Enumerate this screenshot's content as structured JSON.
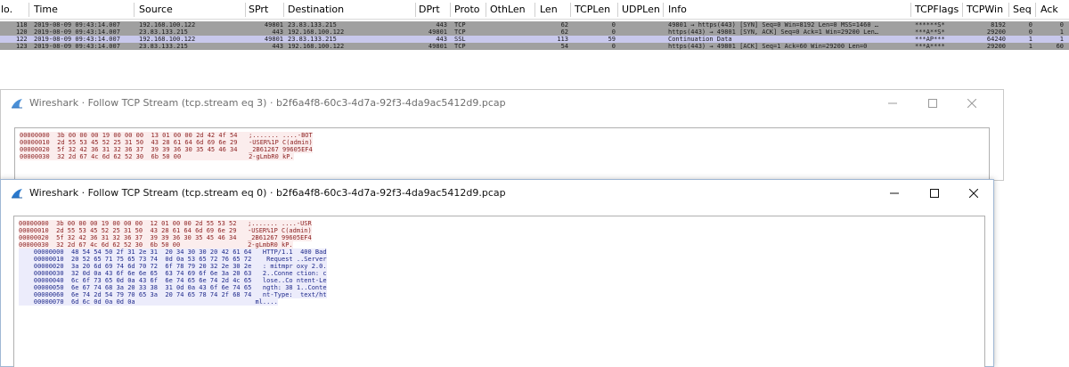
{
  "packet_list": {
    "columns": [
      "lo.",
      "Time",
      "Source",
      "SPrt",
      "Destination",
      "DPrt",
      "Proto",
      "OthLen",
      "Len",
      "TCPLen",
      "UDPLen",
      "Info",
      "TCPFlags",
      "TCPWin",
      "Seq",
      "Ack"
    ],
    "rows": [
      {
        "no": "118",
        "time": "2019-08-09 09:43:14.007",
        "source": "192.168.100.122",
        "sprt": "49801",
        "destination": "23.83.133.215",
        "dprt": "443",
        "proto": "TCP",
        "len": "62",
        "tcplen": "0",
        "info": "49801 → https(443) [SYN] Seq=0 Win=8192 Len=0 MSS=1460 …",
        "tcpflags": "******S*",
        "tcpwin": "8192",
        "seq": "0",
        "ack": "0",
        "bg": "#a0a0a0"
      },
      {
        "no": "120",
        "time": "2019-08-09 09:43:14.007",
        "source": "23.83.133.215",
        "sprt": "443",
        "destination": "192.168.100.122",
        "dprt": "49801",
        "proto": "TCP",
        "len": "62",
        "tcplen": "0",
        "info": "https(443) → 49801 [SYN, ACK] Seq=0 Ack=1 Win=29200 Len…",
        "tcpflags": "***A**S*",
        "tcpwin": "29200",
        "seq": "0",
        "ack": "1",
        "bg": "#a0a0a0"
      },
      {
        "no": "122",
        "time": "2019-08-09 09:43:14.007",
        "source": "192.168.100.122",
        "sprt": "49801",
        "destination": "23.83.133.215",
        "dprt": "443",
        "proto": "SSL",
        "len": "113",
        "tcplen": "59",
        "info": "Continuation Data",
        "tcpflags": "***AP***",
        "tcpwin": "64240",
        "seq": "1",
        "ack": "1",
        "bg": "#c8c8ec"
      },
      {
        "no": "123",
        "time": "2019-08-09 09:43:14.007",
        "source": "23.83.133.215",
        "sprt": "443",
        "destination": "192.168.100.122",
        "dprt": "49801",
        "proto": "TCP",
        "len": "54",
        "tcplen": "0",
        "info": "https(443) → 49801 [ACK] Seq=1 Ack=60 Win=29200 Len=0",
        "tcpflags": "***A****",
        "tcpwin": "29200",
        "seq": "1",
        "ack": "60",
        "bg": "#a0a0a0"
      }
    ]
  },
  "windows": [
    {
      "title": "Wireshark · Follow TCP Stream (tcp.stream eq 3) · b2f6a4f8-60c3-4d7a-92f3-4da9ac5412d9.pcap",
      "lines": [
        {
          "dir": "client",
          "text": "00000000  3b 00 00 00 19 00 00 00  13 01 00 00 2d 42 4f 54   ;....... ....-BOT"
        },
        {
          "dir": "client",
          "text": "00000010  2d 55 53 45 52 25 31 50  43 28 61 64 6d 69 6e 29   -USER%1P C(admin)"
        },
        {
          "dir": "client",
          "text": "00000020  5f 32 42 36 31 32 36 37  39 39 36 30 35 45 46 34   _2B61267 99605EF4"
        },
        {
          "dir": "client",
          "text": "00000030  32 2d 67 4c 6d 62 52 30  6b 50 00                  2-gLmbR0 kP."
        }
      ]
    },
    {
      "title": "Wireshark · Follow TCP Stream (tcp.stream eq 0) · b2f6a4f8-60c3-4d7a-92f3-4da9ac5412d9.pcap",
      "lines": [
        {
          "dir": "client",
          "text": "00000000  3b 00 00 00 19 00 00 00  12 01 00 00 2d 55 53 52   ;....... ....-USR"
        },
        {
          "dir": "client",
          "text": "00000010  2d 55 53 45 52 25 31 50  43 28 61 64 6d 69 6e 29   -USER%1P C(admin)"
        },
        {
          "dir": "client",
          "text": "00000020  5f 32 42 36 31 32 36 37  39 39 36 30 35 45 46 34   _2B61267 99605EF4"
        },
        {
          "dir": "client",
          "text": "00000030  32 2d 67 4c 6d 62 52 30  6b 50 00                  2-gLmbR0 kP."
        },
        {
          "dir": "server",
          "text": "    00000000  48 54 54 50 2f 31 2e 31  20 34 30 30 20 42 61 64   HTTP/1.1  400 Bad"
        },
        {
          "dir": "server",
          "text": "    00000010  20 52 65 71 75 65 73 74  0d 0a 53 65 72 76 65 72    Request ..Server"
        },
        {
          "dir": "server",
          "text": "    00000020  3a 20 6d 69 74 6d 70 72  6f 78 79 20 32 2e 30 2e   : mitmpr oxy 2.0."
        },
        {
          "dir": "server",
          "text": "    00000030  32 0d 0a 43 6f 6e 6e 65  63 74 69 6f 6e 3a 20 63   2..Conne ction: c"
        },
        {
          "dir": "server",
          "text": "    00000040  6c 6f 73 65 0d 0a 43 6f  6e 74 65 6e 74 2d 4c 65   lose..Co ntent-Le"
        },
        {
          "dir": "server",
          "text": "    00000050  6e 67 74 68 3a 20 33 38  31 0d 0a 43 6f 6e 74 65   ngth: 38 1..Conte"
        },
        {
          "dir": "server",
          "text": "    00000060  6e 74 2d 54 79 70 65 3a  20 74 65 78 74 2f 68 74   nt-Type:  text/ht"
        },
        {
          "dir": "server",
          "text": "    00000070  6d 6c 0d 0a 0d 0a                                ml...."
        }
      ]
    }
  ]
}
